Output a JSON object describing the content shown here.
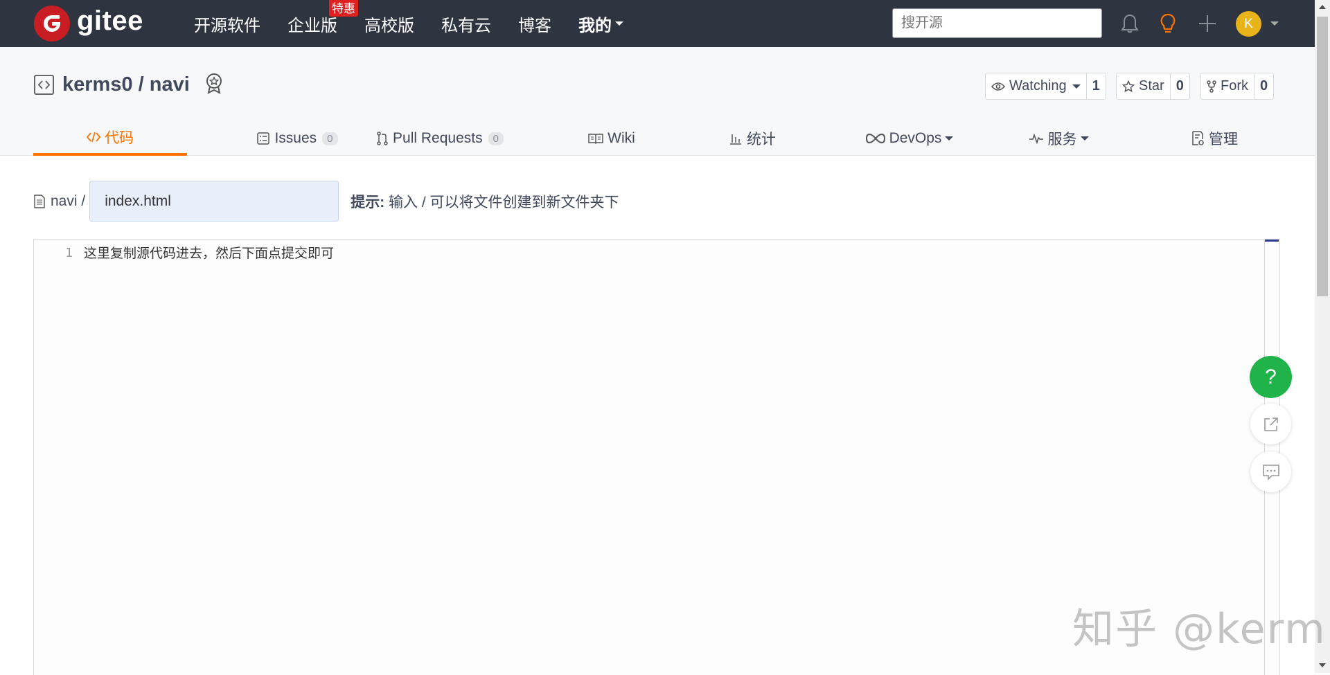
{
  "navbar": {
    "logo_text": "gitee",
    "links": [
      {
        "label": "开源软件"
      },
      {
        "label": "企业版",
        "badge": "特惠"
      },
      {
        "label": "高校版"
      },
      {
        "label": "私有云"
      },
      {
        "label": "博客"
      }
    ],
    "mine_label": "我的",
    "search_placeholder": "搜开源",
    "avatar_initial": "K",
    "accent_color": "#fe7300"
  },
  "repo": {
    "title": "kerms0 / navi",
    "watching_label": "Watching",
    "watching_count": "1",
    "star_label": "Star",
    "star_count": "0",
    "fork_label": "Fork",
    "fork_count": "0"
  },
  "tabs": [
    {
      "label": "代码",
      "icon": "code-icon",
      "active": true
    },
    {
      "label": "Issues",
      "icon": "issues-icon",
      "count": "0"
    },
    {
      "label": "Pull Requests",
      "icon": "pull-request-icon",
      "count": "0"
    },
    {
      "label": "Wiki",
      "icon": "book-icon"
    },
    {
      "label": "统计",
      "icon": "bar-chart-icon"
    },
    {
      "label": "DevOps",
      "icon": "infinity-icon",
      "dropdown": true
    },
    {
      "label": "服务",
      "icon": "pulse-icon",
      "dropdown": true
    },
    {
      "label": "管理",
      "icon": "settings-doc-icon"
    }
  ],
  "file_path": {
    "root": "navi /",
    "filename_value": "index.html",
    "hint_label": "提示:",
    "hint_text": "输入 / 可以将文件创建到新文件夹下"
  },
  "editor": {
    "lines": [
      {
        "number": "1",
        "text": "这里复制源代码进去，然后下面点提交即可"
      }
    ]
  },
  "floating": {
    "help_label": "?"
  },
  "watermark": "知乎 @kerm"
}
